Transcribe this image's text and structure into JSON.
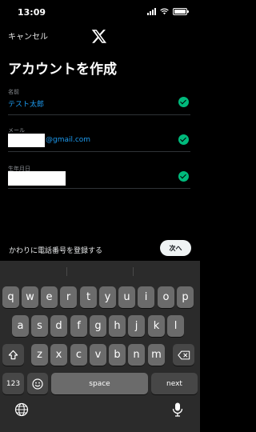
{
  "status": {
    "time": "13:09"
  },
  "nav": {
    "cancel": "キャンセル",
    "logo": "x-logo"
  },
  "title": "アカウントを作成",
  "fields": [
    {
      "label": "名前",
      "value": "テスト太郎",
      "status": "check-icon"
    },
    {
      "label": "メール",
      "value": "@gmail.com",
      "status": "check-icon"
    },
    {
      "label": "生年月日",
      "value": "",
      "status": "check-icon"
    }
  ],
  "footer": {
    "alt_link": "かわりに電話番号を登録する",
    "next": "次へ"
  },
  "keyboard": {
    "row1": [
      "q",
      "w",
      "e",
      "r",
      "t",
      "y",
      "u",
      "i",
      "o",
      "p"
    ],
    "row2": [
      "a",
      "s",
      "d",
      "f",
      "g",
      "h",
      "j",
      "k",
      "l"
    ],
    "row3": [
      "z",
      "x",
      "c",
      "v",
      "b",
      "n",
      "m"
    ],
    "numbers": "123",
    "space": "space",
    "next": "next",
    "icons": [
      "shift-icon",
      "backspace-icon",
      "emoji-icon",
      "globe-icon",
      "microphone-icon"
    ]
  },
  "colors": {
    "accent": "#1d9bf0",
    "success": "#00ba7c",
    "background": "#000000",
    "keyboard": "#2b2b2b"
  }
}
